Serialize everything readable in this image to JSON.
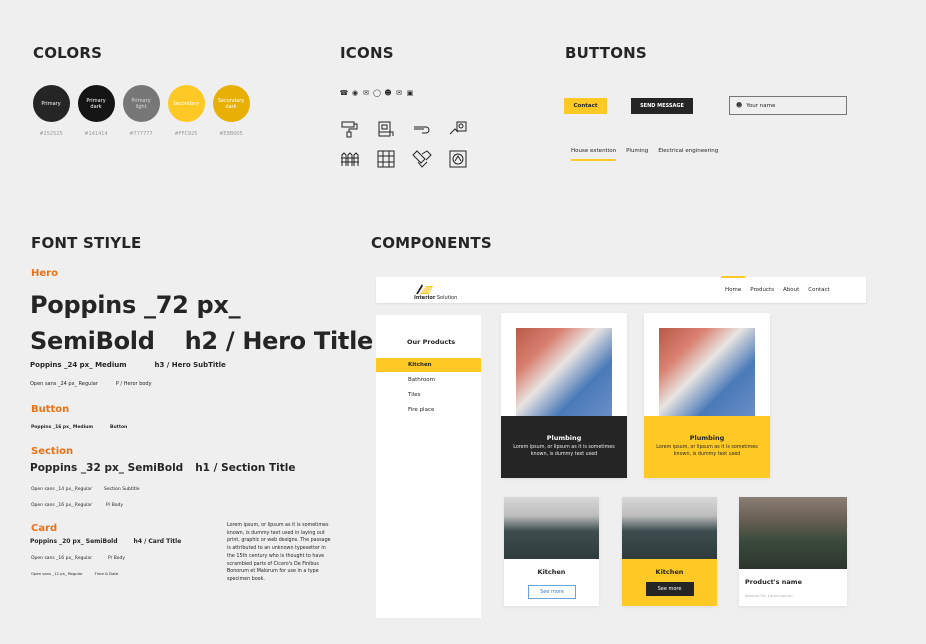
{
  "colors": {
    "title": "COLORS",
    "swatches": [
      {
        "label_line1": "Primary",
        "label_line2": "",
        "hex": "#252525"
      },
      {
        "label_line1": "Primary",
        "label_line2": "dark",
        "hex": "#141414"
      },
      {
        "label_line1": "Primary",
        "label_line2": "light",
        "hex": "#777777"
      },
      {
        "label_line1": "Secondary",
        "label_line2": "",
        "hex": "#FFC925"
      },
      {
        "label_line1": "Secondary",
        "label_line2": "dark",
        "hex": "#E8B005"
      }
    ]
  },
  "icons": {
    "title": "ICONS",
    "small": [
      "phone-icon",
      "location-icon",
      "mail-icon",
      "whatsapp-icon",
      "user-icon",
      "envelope-icon",
      "chat-icon"
    ],
    "large": [
      "paint-roller-icon",
      "house-extension-icon",
      "plumbing-icon",
      "electrical-icon",
      "fence-icon",
      "tiles-icon",
      "parquet-icon",
      "fireplace-icon"
    ]
  },
  "buttons": {
    "title": "BUTTONS",
    "contact_label": "Contact",
    "send_label": "SEND MESSAGE",
    "name_placeholder": "Your name",
    "tabs": [
      "House extention",
      "Pluming",
      "Electrical engineering"
    ]
  },
  "fontstyle": {
    "title": "FONT STIYLE",
    "hero_label": "Hero",
    "hero_line1": "Poppins _72  px_",
    "hero_line2a": "SemiBold",
    "hero_line2b": "h2 / Hero Title",
    "hero_sub_a": "Poppins _24  px_ Medium",
    "hero_sub_b": "h3 / Hero SubTitle",
    "hero_body_a": "Open sans _24 px_ Regular",
    "hero_body_b": "P / Heror body",
    "button_label": "Button",
    "button_a": "Poppins _16 px_ Medium",
    "button_b": "Button",
    "section_label": "Section",
    "section_a": "Poppins _32  px_ SemiBold",
    "section_b": "h1 / Section Title",
    "section_sub_a": "Open sans _14 px_ Regular",
    "section_sub_b": "Section Subtitle",
    "section_body_a": "Open sans _16 px_ Regular",
    "section_body_b": "P/ Body",
    "card_label": "Card",
    "card_a": "Poppins _20  px_ SemiBold",
    "card_b": "h4 / Card Title",
    "card_body_a": "Open sans _16 px_ Regular",
    "card_body_b": "P/ Body",
    "card_small_a": "Open sans _12 px_ Regular",
    "card_small_b": "Time & Date",
    "lorem": "Lorem ipsum, or lipsum as it is sometimes known, is dummy text used in laying out print, graphic or web designs. The passage is attributed to an unknown typesetter in the 15th century who is thought to have scrambled parts of Cicero's De Finibus Bonorum et Malorum for use in a type specimen book."
  },
  "components": {
    "title": "COMPONENTS",
    "logo_text_bold": "Interior",
    "logo_text": " Solution",
    "nav": [
      "Home",
      "Products",
      "About",
      "Contact"
    ],
    "sidebar_title": "Our Products",
    "sidebar_items": [
      "Kitchen",
      "Bathroom",
      "Tiles",
      "Fire place"
    ],
    "plumb_title": "Plumbing",
    "plumb_text": "Lorem ipsum, or lipsum as it is sometimes known, is dummy text used",
    "kitchen_title": "Kitchen",
    "see_more": "See more",
    "product_name": "Product's name",
    "product_meta": "Aenean.Sit. Lorem.ipsum"
  }
}
